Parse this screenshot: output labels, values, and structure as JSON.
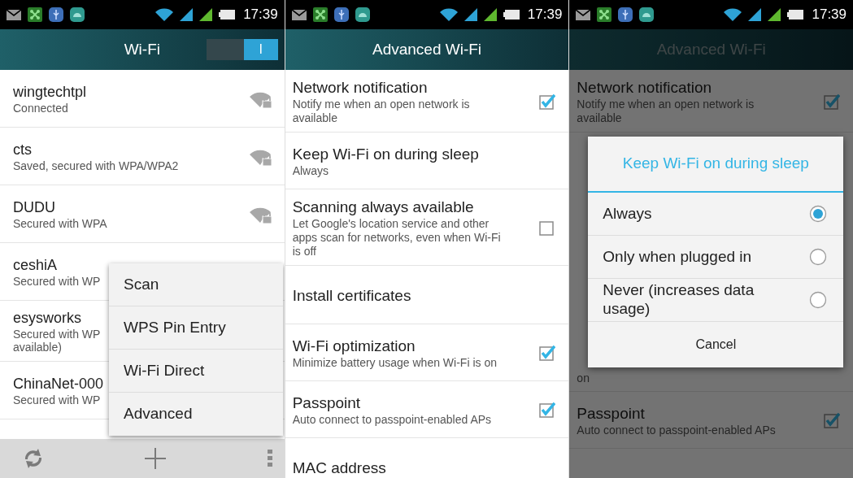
{
  "screens": [
    {
      "kind": "wifi_list",
      "status_bar": {
        "time": "17:39"
      },
      "title": "Wi-Fi",
      "wifi_switch": {
        "on": true,
        "label": "I"
      },
      "networks": [
        {
          "name": "wingtechtpl",
          "status": [
            "Connected"
          ]
        },
        {
          "name": "cts",
          "status": [
            "Saved, secured with WPA/WPA2"
          ]
        },
        {
          "name": "DUDU",
          "status": [
            "Secured with WPA"
          ]
        },
        {
          "name": "ceshiA",
          "status": [
            "Secured with WP"
          ]
        },
        {
          "name": "esysworks",
          "status": [
            "Secured with WP",
            "available)"
          ]
        },
        {
          "name": "ChinaNet-000",
          "status": [
            "Secured with WP"
          ]
        }
      ],
      "overflow_menu": [
        "Scan",
        "WPS Pin Entry",
        "Wi-Fi Direct",
        "Advanced"
      ]
    },
    {
      "kind": "settings",
      "status_bar": {
        "time": "17:39"
      },
      "title": "Advanced Wi-Fi",
      "dimmed": false,
      "items": [
        {
          "kind": "checkbox",
          "title": "Network notification",
          "summary": "Notify me when an open network is available",
          "checked": true
        },
        {
          "kind": "plain",
          "title": "Keep Wi-Fi on during sleep",
          "summary": "Always"
        },
        {
          "kind": "checkbox",
          "title": "Scanning always available",
          "summary": "Let Google's location service and other apps scan for networks, even when Wi-Fi is off",
          "checked": false
        },
        {
          "kind": "plain",
          "title": "Install certificates"
        },
        {
          "kind": "checkbox",
          "title": "Wi-Fi optimization",
          "summary": "Minimize battery usage when Wi-Fi is on",
          "checked": true
        },
        {
          "kind": "checkbox",
          "title": "Passpoint",
          "summary": "Auto connect to passpoint-enabled APs",
          "checked": true
        },
        {
          "kind": "plain",
          "title": "MAC address"
        }
      ]
    },
    {
      "kind": "settings",
      "status_bar": {
        "time": "17:39"
      },
      "title": "Advanced Wi-Fi",
      "dimmed": true,
      "items": [
        {
          "kind": "checkbox",
          "title": "Network notification",
          "summary": "Notify me when an open network is available",
          "checked": true
        },
        {
          "kind": "covered"
        },
        {
          "kind": "fragment",
          "summary": "on"
        },
        {
          "kind": "checkbox",
          "title": "Passpoint",
          "summary": "Auto connect to passpoint-enabled APs",
          "checked": true
        }
      ],
      "dialog": {
        "title": "Keep Wi-Fi on during sleep",
        "options": [
          {
            "label": "Always",
            "selected": true
          },
          {
            "label": "Only when plugged in",
            "selected": false
          },
          {
            "label": "Never (increases data usage)",
            "selected": false
          }
        ],
        "button": "Cancel"
      }
    }
  ]
}
